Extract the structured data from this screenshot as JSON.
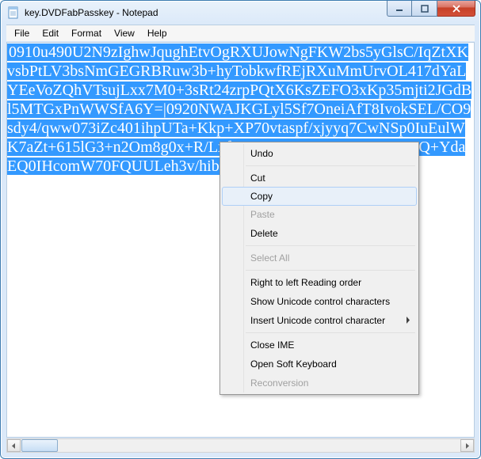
{
  "title": "key.DVDFabPasskey - Notepad",
  "menubar": {
    "file": "File",
    "edit": "Edit",
    "format": "Format",
    "view": "View",
    "help": "Help"
  },
  "content": "0910u490U2N9zIghwJqughEtvOgRXUJowNgFKW2bs5yGlsC/IqZtXKvsbPtLV3bsNmGEGRBRuw3b+hyTobkwfREjRXuMmUrvOL417dYaLYEeVoZQhVTsujLxx7M0+3sRt24zrpPQtX6KsZEFO3xKp35mjti2JGdBl5MTGxPnWWSfA6Y=|0920NWAJKGLyl5Sf7OneiAfT8IvokSEL/CO9sdy4/qww073iZc401ihpUTa+Kkp+XP70vtaspf/xjyyq7CwNSp0IuEulWK7aZt+615lG3+n2Om8g0x+R/LxfIWvNpMnG86uqV5Dj5PvWQ+YdaEQ0IHcomW70FQUULeh3v/hibfI=",
  "context": {
    "undo": "Undo",
    "cut": "Cut",
    "copy": "Copy",
    "paste": "Paste",
    "delete": "Delete",
    "select_all": "Select All",
    "rtl": "Right to left Reading order",
    "show_unicode": "Show Unicode control characters",
    "insert_unicode": "Insert Unicode control character",
    "close_ime": "Close IME",
    "soft_kbd": "Open Soft Keyboard",
    "reconv": "Reconversion"
  }
}
